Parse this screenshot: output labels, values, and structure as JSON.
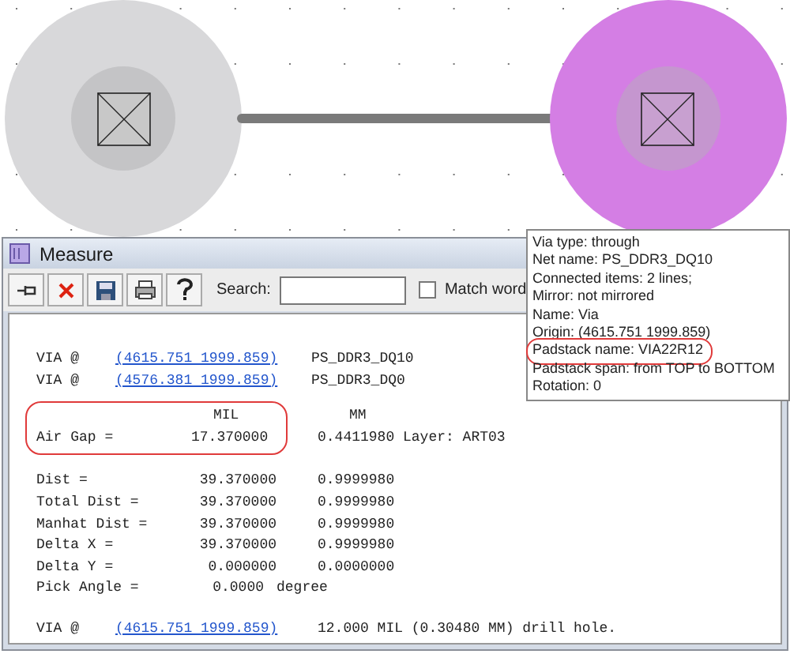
{
  "window": {
    "title": "Measure"
  },
  "toolbar": {
    "buttons": [
      {
        "kind": "pin"
      },
      {
        "kind": "delete"
      },
      {
        "kind": "save"
      },
      {
        "kind": "print"
      },
      {
        "kind": "help"
      }
    ],
    "search_label": "Search:",
    "match_word": {
      "label": "Match word",
      "checked": false
    }
  },
  "report": {
    "vias": [
      {
        "label": "VIA @",
        "coords": "(4615.751 1999.859)",
        "net": "PS_DDR3_DQ10"
      },
      {
        "label": "VIA @",
        "coords": "(4576.381 1999.859)",
        "net": "PS_DDR3_DQ0"
      }
    ],
    "units": {
      "mil": "MIL",
      "mm": "MM"
    },
    "air_gap": {
      "label": "Air Gap =",
      "mil": "17.370000",
      "mm": "0.4411980",
      "layer": "Layer: ART03",
      "highlighted": true
    },
    "measurements": [
      {
        "label": "Dist =",
        "mil": "39.370000",
        "mm": "0.9999980"
      },
      {
        "label": "Total Dist =",
        "mil": "39.370000",
        "mm": "0.9999980"
      },
      {
        "label": "Manhat Dist =",
        "mil": "39.370000",
        "mm": "0.9999980"
      },
      {
        "label": "Delta X =",
        "mil": "39.370000",
        "mm": "0.9999980"
      },
      {
        "label": "Delta Y =",
        "mil": "0.000000",
        "mm": "0.0000000"
      }
    ],
    "pick_angle": {
      "label": "Pick Angle =",
      "value": "0.0000",
      "unit": "degree"
    },
    "drill": {
      "label": "VIA @",
      "coords": "(4615.751 1999.859)",
      "text": "12.000 MIL (0.30480 MM) drill hole."
    }
  },
  "tooltip": {
    "lines": [
      {
        "text": "Via type: through",
        "highlighted": false
      },
      {
        "text": "Net name: PS_DDR3_DQ10",
        "highlighted": false
      },
      {
        "text": "Connected items: 2 lines;",
        "highlighted": false
      },
      {
        "text": "Mirror: not mirrored",
        "highlighted": false
      },
      {
        "text": "Name: Via",
        "highlighted": false
      },
      {
        "text": "Origin: (4615.751 1999.859)",
        "highlighted": false
      },
      {
        "text": "Padstack name: VIA22R12",
        "highlighted": true
      },
      {
        "text": "Padstack span: from TOP to BOTTOM",
        "highlighted": false
      },
      {
        "text": "Rotation: 0",
        "highlighted": false
      }
    ]
  }
}
